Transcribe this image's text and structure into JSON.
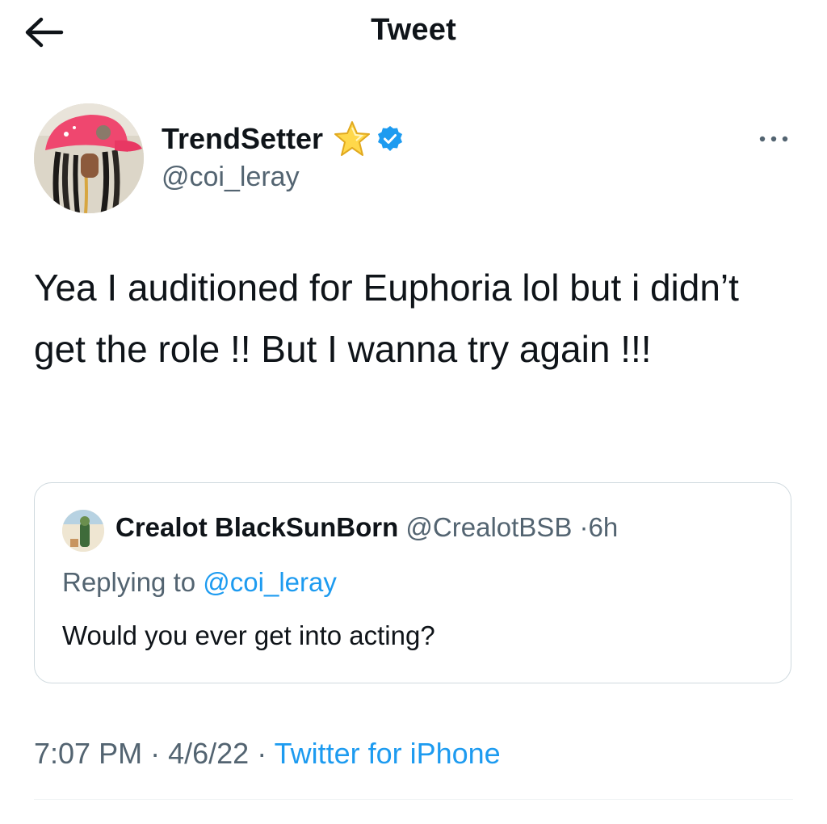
{
  "header": {
    "title": "Tweet",
    "back_icon": "arrow-left-icon"
  },
  "tweet": {
    "author": {
      "display_name": "TrendSetter",
      "handle": "@coi_leray",
      "badges": [
        "star-emoji-icon",
        "verified-badge-icon"
      ]
    },
    "text": "Yea I auditioned for Euphoria lol but i didn’t get the role !! But I wanna try again !!!",
    "quoted": {
      "display_name": "Crealot BlackSunBorn",
      "handle": "@CrealotBSB",
      "separator": "·",
      "age": "6h",
      "replying_prefix": "Replying to",
      "replying_handle": "@coi_leray",
      "text": "Would you ever get into acting?"
    },
    "meta": {
      "time": "7:07 PM",
      "date": "4/6/22",
      "separator": "·",
      "source": "Twitter for iPhone"
    }
  },
  "colors": {
    "accent": "#1d9bf0",
    "secondary_text": "#536471",
    "border": "#cfd9de",
    "text": "#0f1419"
  }
}
